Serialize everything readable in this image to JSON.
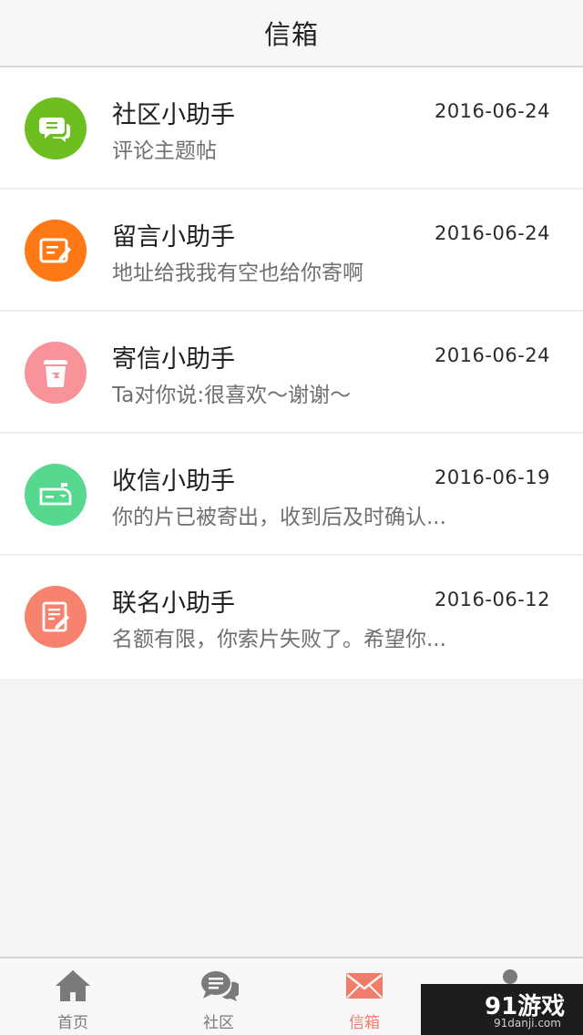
{
  "header": {
    "title": "信箱"
  },
  "messages": [
    {
      "name": "社区小助手",
      "preview": "评论主题帖",
      "date": "2016-06-24",
      "avatar_color": "#6cbf1f",
      "icon": "chat-bubbles-icon"
    },
    {
      "name": "留言小助手",
      "preview": "地址给我我有空也给你寄啊",
      "date": "2016-06-24",
      "avatar_color": "#ff7a16",
      "icon": "note-pen-icon"
    },
    {
      "name": "寄信小助手",
      "preview": "Ta对你说:很喜欢～谢谢～",
      "date": "2016-06-24",
      "avatar_color": "#f8939a",
      "icon": "mail-bin-icon"
    },
    {
      "name": "收信小助手",
      "preview": "你的片已被寄出，收到后及时确认...",
      "date": "2016-06-19",
      "avatar_color": "#57d88f",
      "icon": "mailbox-icon"
    },
    {
      "name": "联名小助手",
      "preview": "名额有限，你索片失败了。希望你...",
      "date": "2016-06-12",
      "avatar_color": "#f7836f",
      "icon": "document-pen-icon"
    }
  ],
  "tabbar": {
    "tabs": [
      {
        "label": "首页",
        "icon": "home-icon",
        "active": false
      },
      {
        "label": "社区",
        "icon": "chat-bubbles-icon",
        "active": false
      },
      {
        "label": "信箱",
        "icon": "envelope-icon",
        "active": true
      },
      {
        "label": "",
        "icon": "person-icon",
        "active": false
      }
    ],
    "active_color": "#f27c6b"
  },
  "watermark": {
    "main": "91游戏",
    "sub": "91danji.com"
  }
}
